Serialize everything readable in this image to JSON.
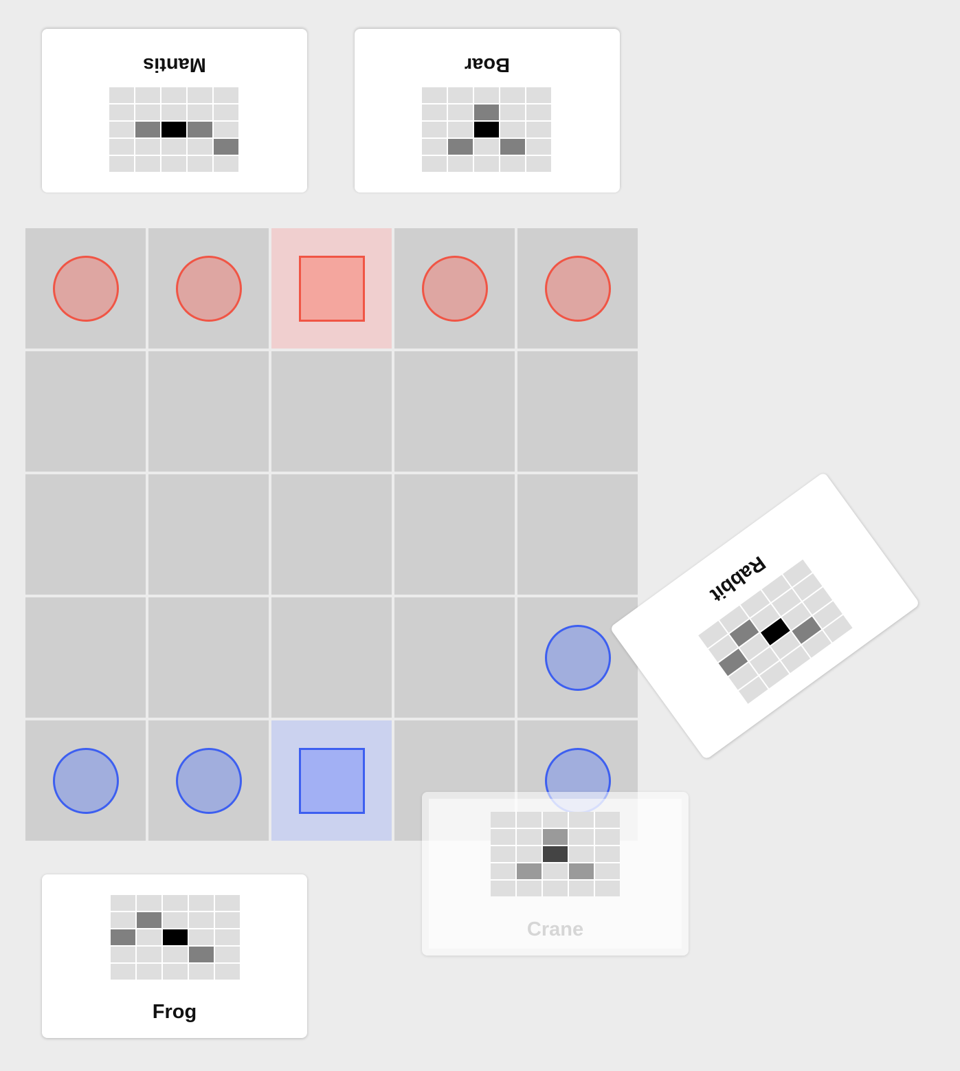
{
  "cards": {
    "opponent_left": {
      "name": "Mantis",
      "moves": [
        [
          0,
          1
        ],
        [
          1,
          2
        ],
        [
          3,
          2
        ]
      ]
    },
    "opponent_right": {
      "name": "Boar",
      "moves": [
        [
          1,
          1
        ],
        [
          3,
          1
        ],
        [
          2,
          3
        ]
      ]
    },
    "player_left": {
      "name": "Frog",
      "moves": [
        [
          1,
          1
        ],
        [
          0,
          2
        ],
        [
          3,
          3
        ]
      ]
    },
    "next_card": {
      "name": "Rabbit",
      "moves": [
        [
          1,
          1
        ],
        [
          3,
          3
        ],
        [
          4,
          2
        ]
      ]
    },
    "ghost_card": {
      "name": "Crane",
      "moves": [
        [
          2,
          1
        ],
        [
          1,
          3
        ],
        [
          3,
          3
        ]
      ]
    }
  },
  "board": {
    "size": 5,
    "thrones": [
      {
        "row": 0,
        "col": 2,
        "color": "red"
      },
      {
        "row": 4,
        "col": 2,
        "color": "blue"
      }
    ],
    "pieces": [
      {
        "row": 0,
        "col": 0,
        "color": "red",
        "type": "pawn"
      },
      {
        "row": 0,
        "col": 1,
        "color": "red",
        "type": "pawn"
      },
      {
        "row": 0,
        "col": 2,
        "color": "red",
        "type": "master"
      },
      {
        "row": 0,
        "col": 3,
        "color": "red",
        "type": "pawn"
      },
      {
        "row": 0,
        "col": 4,
        "color": "red",
        "type": "pawn"
      },
      {
        "row": 3,
        "col": 4,
        "color": "blue",
        "type": "pawn"
      },
      {
        "row": 4,
        "col": 0,
        "color": "blue",
        "type": "pawn"
      },
      {
        "row": 4,
        "col": 1,
        "color": "blue",
        "type": "pawn"
      },
      {
        "row": 4,
        "col": 2,
        "color": "blue",
        "type": "master"
      },
      {
        "row": 4,
        "col": 4,
        "color": "blue",
        "type": "pawn"
      }
    ]
  }
}
